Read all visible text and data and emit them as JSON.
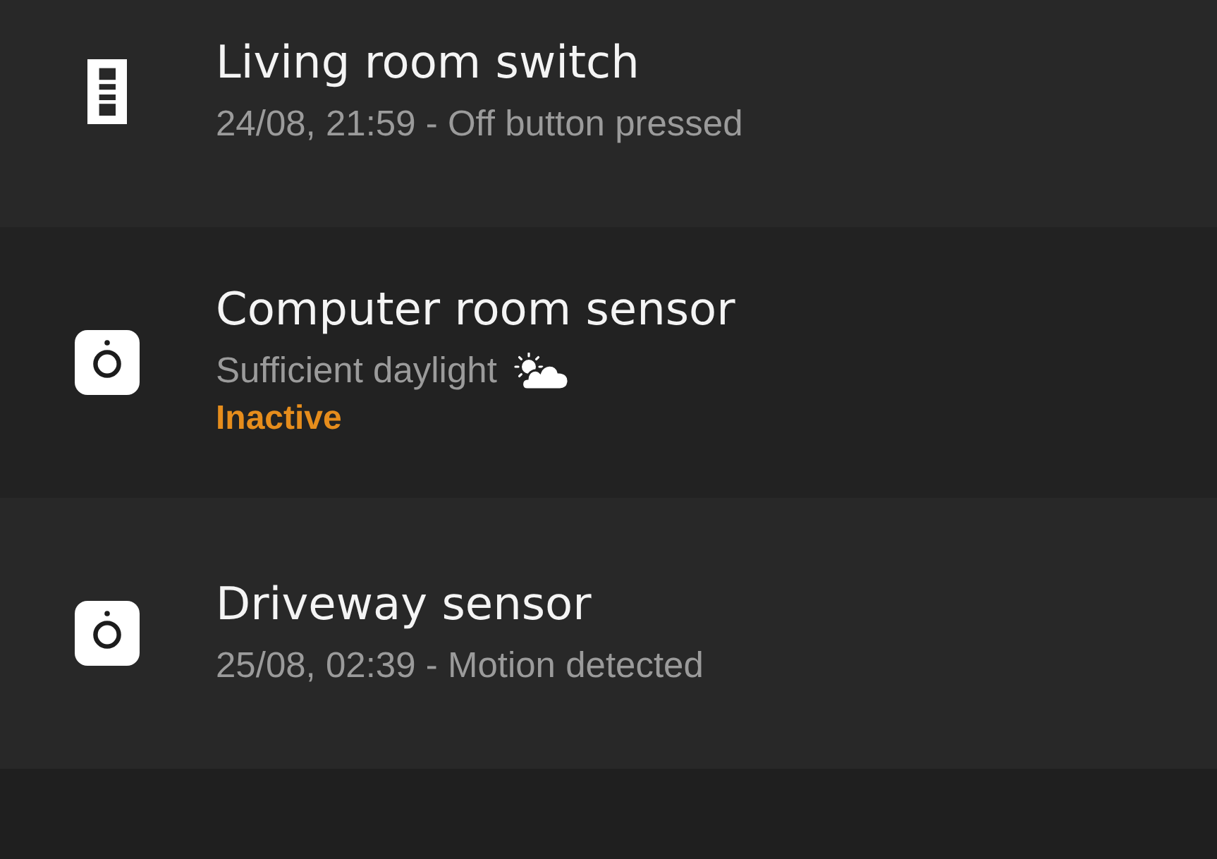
{
  "devices": [
    {
      "kind": "switch",
      "name": "Living room switch",
      "detail": "24/08, 21:59 - Off button pressed",
      "detail_icon": false
    },
    {
      "kind": "sensor",
      "name": "Computer room sensor",
      "detail": "Sufficient daylight",
      "detail_icon": true,
      "status": "Inactive"
    },
    {
      "kind": "sensor",
      "name": "Driveway sensor",
      "detail": "25/08, 02:39 - Motion detected",
      "detail_icon": false
    }
  ]
}
